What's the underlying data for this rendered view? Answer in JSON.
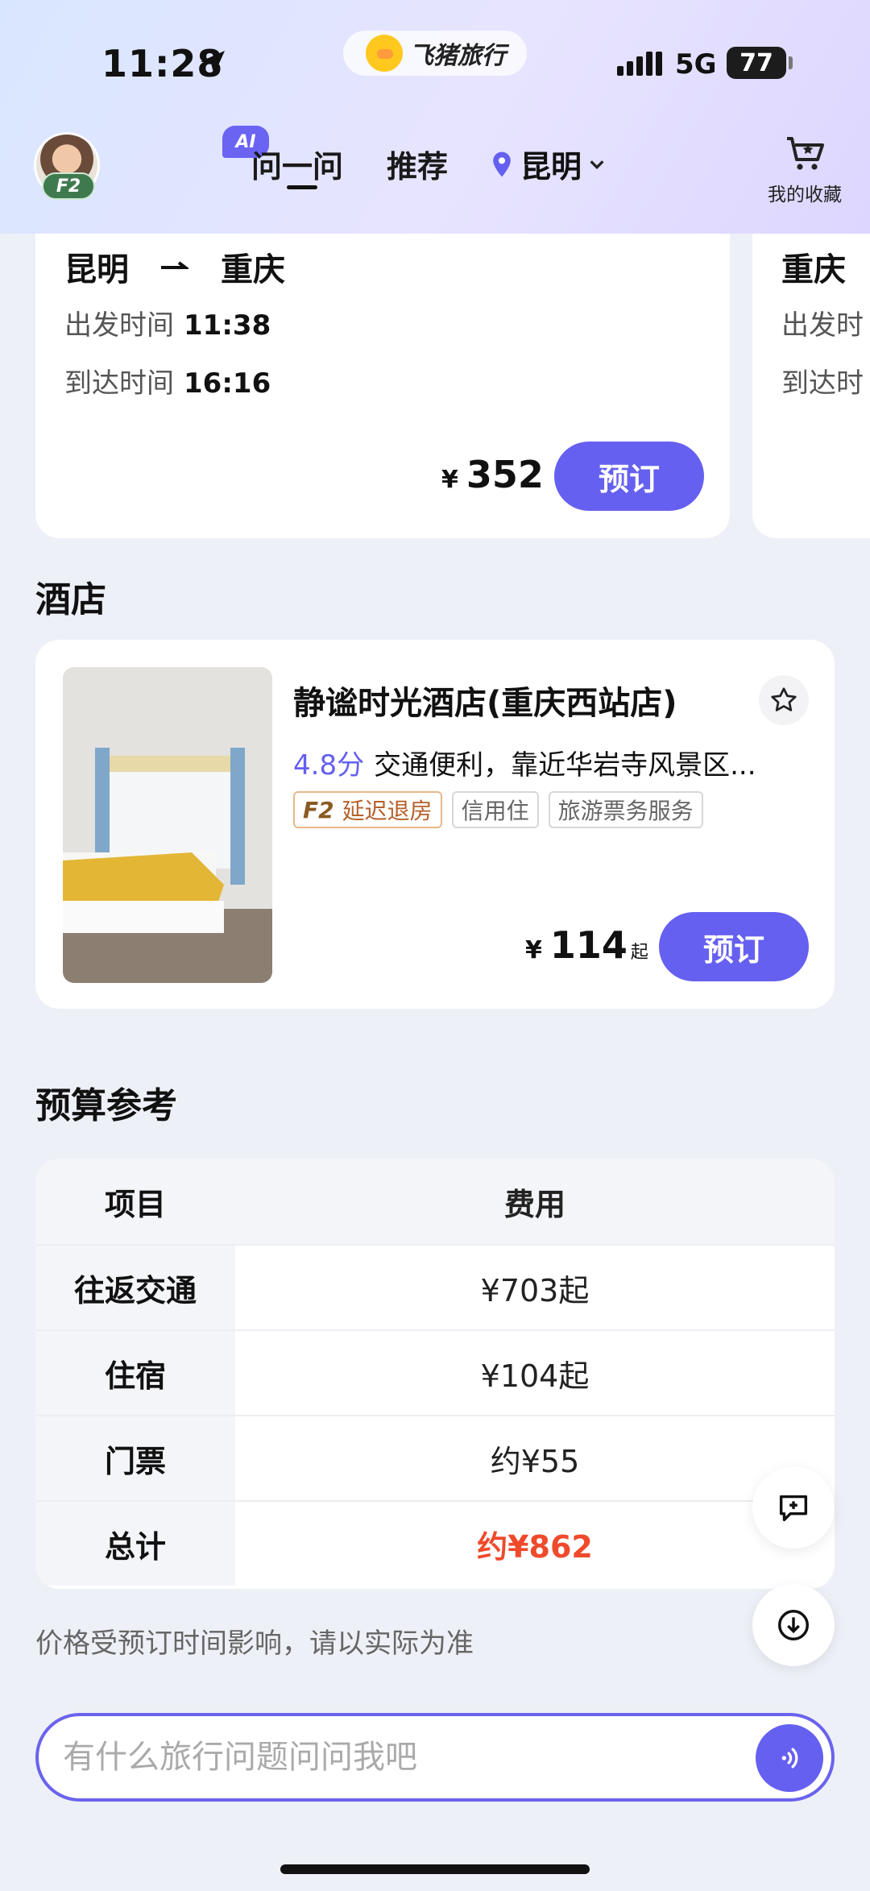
{
  "status": {
    "time": "11:28",
    "app_name": "飞猪旅行",
    "network": "5G",
    "battery": "77"
  },
  "nav": {
    "avatar_badge": "F2",
    "ai_badge": "AI",
    "tab_ask": "问一问",
    "tab_recommend": "推荐",
    "location": "昆明",
    "favorites_label": "我的收藏"
  },
  "trip": {
    "from": "昆明",
    "to": "重庆",
    "depart_label": "出发时间",
    "depart_time": "11:38",
    "arrive_label": "到达时间",
    "arrive_time": "16:16",
    "currency": "¥",
    "price": "352",
    "book_label": "预订"
  },
  "trip_next": {
    "from": "重庆",
    "depart_label": "出发时",
    "arrive_label": "到达时"
  },
  "hotel_section_title": "酒店",
  "hotel": {
    "name": "静谧时光酒店(重庆西站店)",
    "score": "4.8分",
    "desc": "交通便利，靠近华岩寺风景区...",
    "tags": [
      {
        "prefix": "F2",
        "label": "延迟退房"
      },
      {
        "label": "信用住"
      },
      {
        "label": "旅游票务服务"
      }
    ],
    "currency": "¥",
    "price": "114",
    "price_suffix": "起",
    "book_label": "预订"
  },
  "budget_title": "预算参考",
  "budget": {
    "header": {
      "item": "项目",
      "cost": "费用"
    },
    "rows": [
      {
        "item": "往返交通",
        "cost": "¥703起"
      },
      {
        "item": "住宿",
        "cost": "¥104起"
      },
      {
        "item": "门票",
        "cost": "约¥55"
      },
      {
        "item": "总计",
        "cost": "约¥862"
      }
    ]
  },
  "note": "价格受预订时间影响，请以实际为准",
  "input": {
    "placeholder": "有什么旅行问题问问我吧"
  },
  "colors": {
    "accent": "#6560f0",
    "total": "#ef4a2c"
  }
}
